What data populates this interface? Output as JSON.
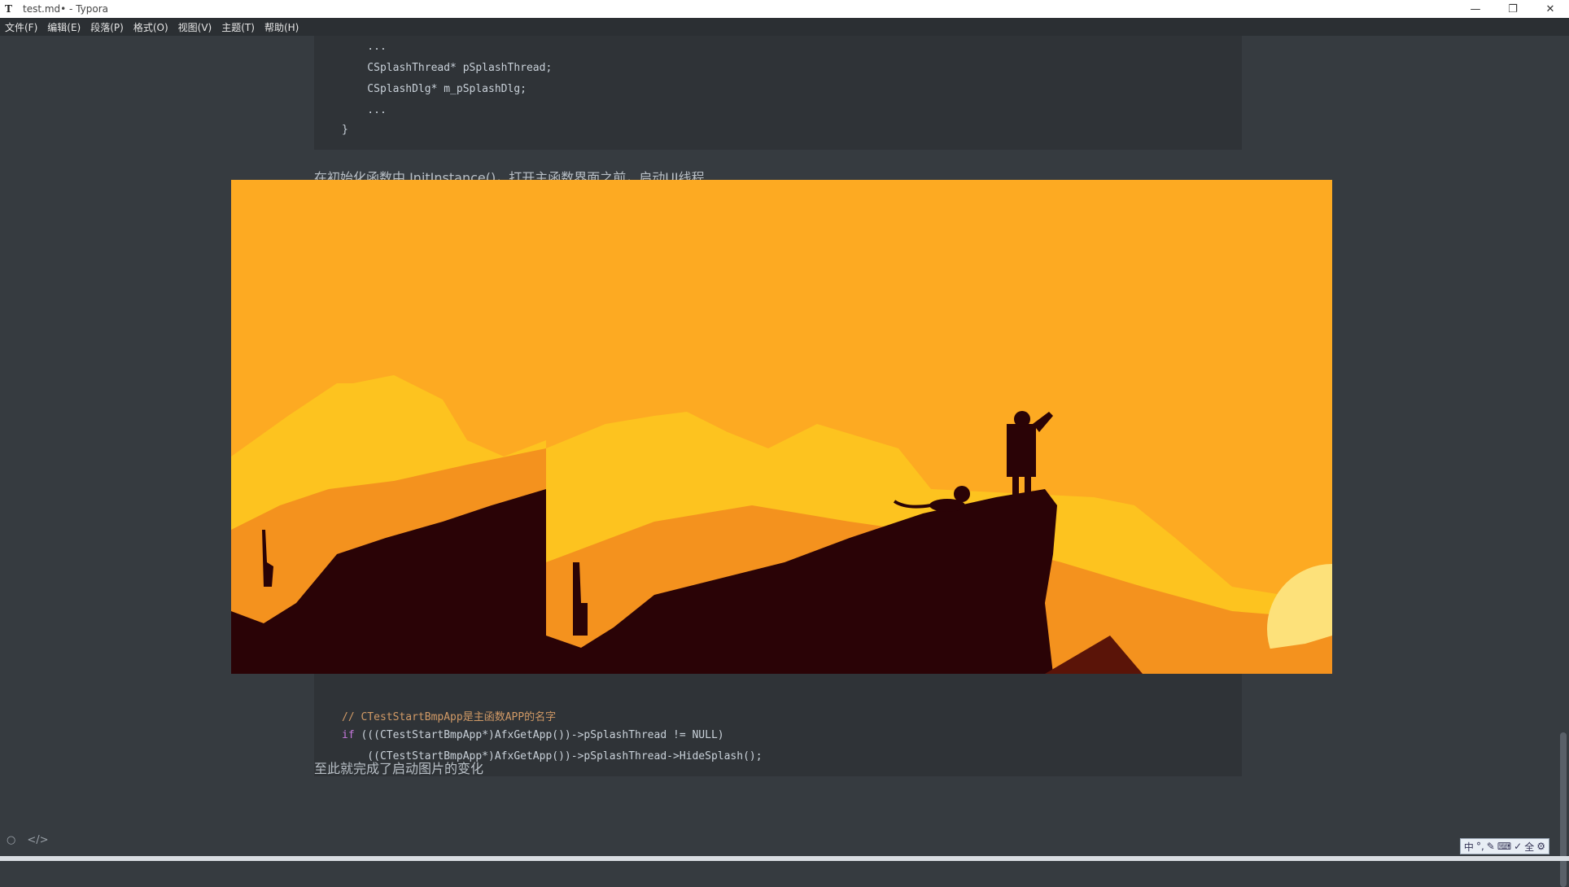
{
  "window": {
    "title": "test.md• - Typora",
    "app_icon": "T"
  },
  "window_controls": {
    "minimize": "—",
    "restore": "❐",
    "close": "✕"
  },
  "menu": [
    "文件(F)",
    "编辑(E)",
    "段落(P)",
    "格式(O)",
    "视图(V)",
    "主题(T)",
    "帮助(H)"
  ],
  "code_top": [
    "    ...",
    "    CSplashThread* pSplashThread;",
    "    CSplashDlg* m_pSplashDlg;",
    "    ...",
    "}"
  ],
  "para_init": "在初始化函数中 InitInstance()，打开主函数界面之前，启动UI线程",
  "code_bottom": {
    "comment": "// CTestStartBmpApp是主函数APP的名字",
    "if_keyword": "if",
    "line1_rest": " (((CTestStartBmpApp*)AfxGetApp())->pSplashThread != NULL)",
    "line2": "    ((CTestStartBmpApp*)AfxGetApp())->pSplashThread->HideSplash();"
  },
  "para_done": "至此就完成了启动图片的变化",
  "bottom_icons": {
    "outline": "○",
    "source": "</>"
  },
  "ime": [
    "中",
    "°,",
    "✎",
    "⌨",
    "✓",
    "全",
    "⚙"
  ],
  "colors": {
    "editor_bg": "#363b40",
    "code_bg": "#2f3337",
    "image_sky": "#fdaa22",
    "silhouette": "#2a0306"
  }
}
